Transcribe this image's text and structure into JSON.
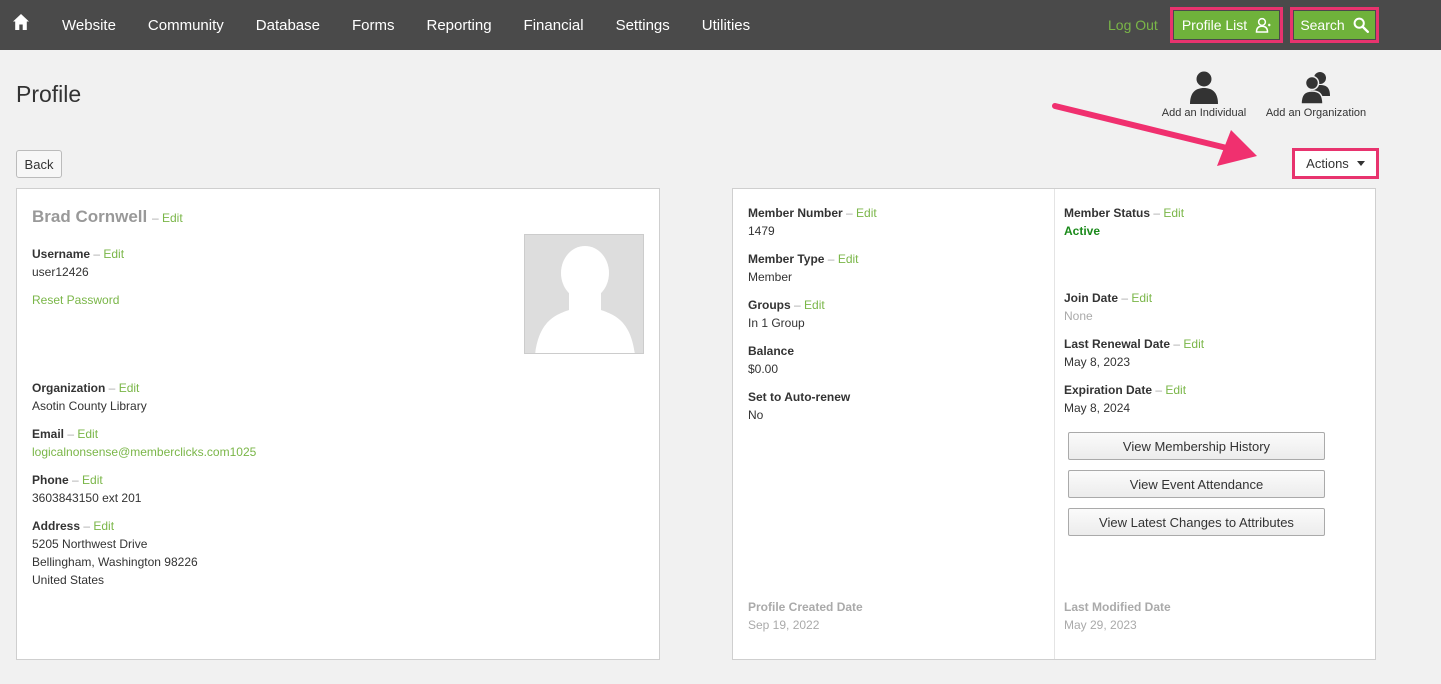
{
  "nav": {
    "items": [
      "Website",
      "Community",
      "Database",
      "Forms",
      "Reporting",
      "Financial",
      "Settings",
      "Utilities"
    ],
    "logout": "Log Out",
    "profile_list": "Profile List",
    "search": "Search"
  },
  "header": {
    "title": "Profile",
    "add_individual": "Add an Individual",
    "add_organization": "Add an Organization",
    "back": "Back",
    "actions": "Actions"
  },
  "left": {
    "name": "Brad Cornwell",
    "edit": "Edit",
    "username_label": "Username",
    "username": "user12426",
    "reset_password": "Reset Password",
    "organization_label": "Organization",
    "organization": "Asotin County Library",
    "email_label": "Email",
    "email": "logicalnonsense@memberclicks.com1025",
    "phone_label": "Phone",
    "phone": "3603843150 ext 201",
    "address_label": "Address",
    "address_line1": "5205 Northwest Drive",
    "address_line2": "Bellingham, Washington 98226",
    "address_line3": "United States"
  },
  "right": {
    "member_number_label": "Member Number",
    "member_number": "1479",
    "member_type_label": "Member Type",
    "member_type": "Member",
    "groups_label": "Groups",
    "groups": "In 1 Group",
    "balance_label": "Balance",
    "balance": "$0.00",
    "auto_renew_label": "Set to Auto-renew",
    "auto_renew": "No",
    "member_status_label": "Member Status",
    "member_status": "Active",
    "join_date_label": "Join Date",
    "join_date": "None",
    "last_renewal_label": "Last Renewal Date",
    "last_renewal": "May 8, 2023",
    "expiration_label": "Expiration Date",
    "expiration": "May 8, 2024",
    "btn_membership_history": "View Membership History",
    "btn_event_attendance": "View Event Attendance",
    "btn_latest_changes": "View Latest Changes to Attributes",
    "created_label": "Profile Created Date",
    "created": "Sep 19, 2022",
    "modified_label": "Last Modified Date",
    "modified": "May 29, 2023"
  },
  "colors": {
    "nav_bg": "#4a4a4a",
    "accent_green": "#6fb23b",
    "highlight_pink": "#e8336e",
    "active_green": "#1a8a1a"
  },
  "icons": [
    "home-icon",
    "person-icon",
    "search-icon",
    "individual-icon",
    "organization-icon",
    "caret-down-icon",
    "avatar-placeholder"
  ]
}
